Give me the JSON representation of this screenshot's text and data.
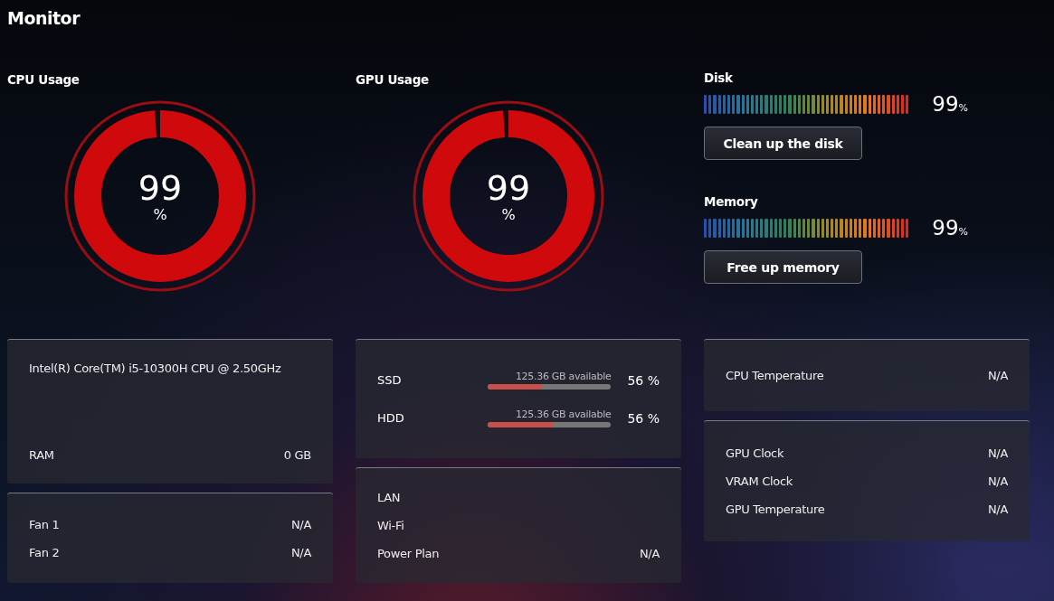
{
  "title": "Monitor",
  "gauges": [
    {
      "label": "CPU Usage",
      "value": "99",
      "unit": "%",
      "level": 0.99
    },
    {
      "label": "GPU Usage",
      "value": "99",
      "unit": "%",
      "level": 0.99
    }
  ],
  "meters": [
    {
      "label": "Disk",
      "value": "99",
      "unit": "%",
      "level": 0.99,
      "button": "Clean up the disk"
    },
    {
      "label": "Memory",
      "value": "99",
      "unit": "%",
      "level": 0.99,
      "button": "Free up memory"
    }
  ],
  "cpu_card": {
    "name": "Intel(R) Core(TM) i5-10300H CPU @ 2.50GHz",
    "rows": [
      {
        "label": "RAM",
        "value": "0 GB"
      }
    ]
  },
  "fan_card": {
    "rows": [
      {
        "label": "Fan 1",
        "value": "N/A"
      },
      {
        "label": "Fan 2",
        "value": "N/A"
      }
    ]
  },
  "drives": [
    {
      "label": "SSD",
      "available": "125.36 GB available",
      "percent": "56 %",
      "level": 0.44
    },
    {
      "label": "HDD",
      "available": "125.36 GB available",
      "percent": "56 %",
      "level": 0.53
    }
  ],
  "network_card": {
    "rows": [
      {
        "label": "LAN"
      },
      {
        "label": "Wi-Fi"
      },
      {
        "label": "Power Plan",
        "value": "N/A"
      }
    ]
  },
  "temp_card": {
    "rows": [
      {
        "label": "CPU Temperature",
        "value": "N/A"
      }
    ]
  },
  "gpu_card": {
    "rows": [
      {
        "label": "GPU Clock",
        "value": "N/A"
      },
      {
        "label": "VRAM Clock",
        "value": "N/A"
      },
      {
        "label": "GPU Temperature",
        "value": "N/A"
      }
    ]
  }
}
